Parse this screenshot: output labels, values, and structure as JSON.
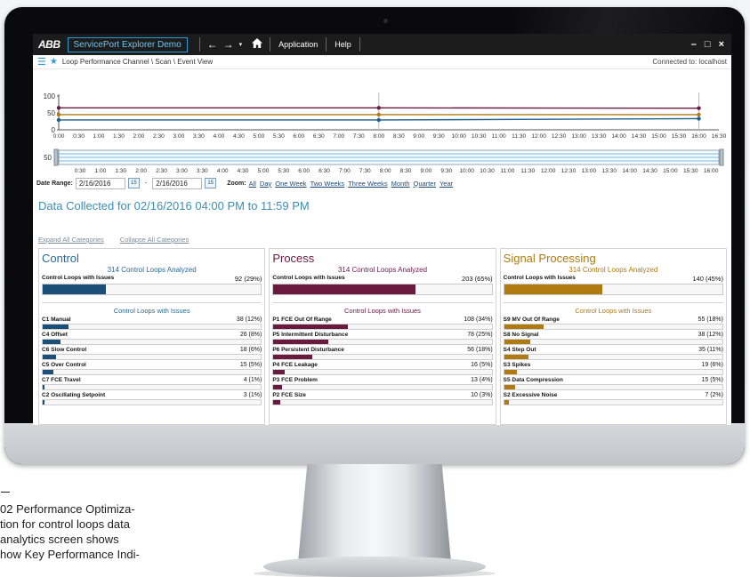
{
  "app": {
    "logo": "ABB",
    "title": "ServicePort Explorer Demo",
    "menu": [
      "Application",
      "Help"
    ],
    "window_controls": [
      "–",
      "□",
      "×"
    ]
  },
  "breadcrumb": "Loop Performance Channel \\ Scan \\ Event View",
  "connection": "Connected to: localhost",
  "chart_data": {
    "type": "line",
    "x": [
      "0:00",
      "0:30",
      "1:00",
      "1:30",
      "2:00",
      "2:30",
      "3:00",
      "3:30",
      "4:00",
      "4:30",
      "5:00",
      "5:30",
      "6:00",
      "6:30",
      "7:00",
      "7:30",
      "8:00",
      "8:30",
      "9:00",
      "9:30",
      "10:00",
      "10:30",
      "11:00",
      "11:30",
      "12:00",
      "12:30",
      "13:00",
      "13:30",
      "14:00",
      "14:30",
      "15:00",
      "15:30",
      "16:00",
      "16:30"
    ],
    "y_ticks": [
      "100",
      "50",
      "0"
    ],
    "ylim": [
      0,
      100
    ],
    "series": [
      {
        "points": [
          [
            0,
            65
          ],
          [
            16,
            65
          ],
          [
            32,
            64
          ]
        ],
        "color": "#6b1a3f"
      },
      {
        "points": [
          [
            0,
            45
          ],
          [
            16,
            45
          ],
          [
            32,
            45
          ]
        ],
        "color": "#b07a10"
      },
      {
        "points": [
          [
            0,
            29
          ],
          [
            16,
            29
          ],
          [
            32,
            33
          ]
        ],
        "color": "#1f5f8b"
      }
    ],
    "navigator": {
      "y_tick": "50",
      "x": [
        "0:30",
        "1:00",
        "1:30",
        "2:00",
        "2:30",
        "3:00",
        "3:30",
        "4:00",
        "4:30",
        "5:00",
        "5:30",
        "6:00",
        "6:30",
        "7:00",
        "7:30",
        "8:00",
        "8:30",
        "9:00",
        "9:30",
        "10:00",
        "10:30",
        "11:00",
        "11:30",
        "12:00",
        "12:30",
        "13:00",
        "13:30",
        "14:00",
        "14:30",
        "15:00",
        "15:30",
        "16:00"
      ]
    }
  },
  "date_range": {
    "label": "Date Range:",
    "from": "2/16/2016",
    "to": "2/16/2016",
    "separator": "-",
    "calendar_icon": "15",
    "zoom_label": "Zoom:",
    "zoom_links": [
      "All",
      "Day",
      "One Week",
      "Two Weeks",
      "Three Weeks",
      "Month",
      "Quarter",
      "Year"
    ]
  },
  "collected_title": "Data Collected for 02/16/2016 04:00 PM to 11:59 PM",
  "expand_all": "Expand All Categories",
  "collapse_all": "Collapse All Categories",
  "panels": [
    {
      "title": "Control",
      "color": "#1b4f78",
      "analyzed": "314 Control Loops Analyzed",
      "summary_label": "Control Loops with Issues",
      "summary_value": "92 (29%)",
      "summary_pct": 29,
      "sub_header": "Control Loops with Issues",
      "items": [
        {
          "label": "C1 Manual",
          "value": "38 (12%)",
          "pct": 12
        },
        {
          "label": "C4 Offset",
          "value": "26 (8%)",
          "pct": 8
        },
        {
          "label": "C6 Slow Control",
          "value": "18 (6%)",
          "pct": 6
        },
        {
          "label": "C5 Over Control",
          "value": "15 (5%)",
          "pct": 5
        },
        {
          "label": "C7 FCE Travel",
          "value": "4 (1%)",
          "pct": 1
        },
        {
          "label": "C2 Oscillating Setpoint",
          "value": "3 (1%)",
          "pct": 1
        }
      ]
    },
    {
      "title": "Process",
      "color": "#6b1a3f",
      "analyzed": "314 Control Loops Analyzed",
      "summary_label": "Control Loops with Issues",
      "summary_value": "203 (65%)",
      "summary_pct": 65,
      "sub_header": "Control Loops with Issues",
      "items": [
        {
          "label": "P1 FCE Out Of Range",
          "value": "108 (34%)",
          "pct": 34
        },
        {
          "label": "P5 Intermittent Disturbance",
          "value": "78 (25%)",
          "pct": 25
        },
        {
          "label": "P6 Persistent Disturbance",
          "value": "56 (18%)",
          "pct": 18
        },
        {
          "label": "P4 FCE Leakage",
          "value": "16 (5%)",
          "pct": 5
        },
        {
          "label": "P3 FCE Problem",
          "value": "13 (4%)",
          "pct": 4
        },
        {
          "label": "P2 FCE Size",
          "value": "10 (3%)",
          "pct": 3
        }
      ]
    },
    {
      "title": "Signal Processing",
      "color": "#b07a10",
      "analyzed": "314 Control Loops Analyzed",
      "summary_label": "Control Loops with Issues",
      "summary_value": "140 (45%)",
      "summary_pct": 45,
      "sub_header": "Control Loops with Issues",
      "items": [
        {
          "label": "S9 MV Out Of Range",
          "value": "55 (18%)",
          "pct": 18
        },
        {
          "label": "S8 No Signal",
          "value": "38 (12%)",
          "pct": 12
        },
        {
          "label": "S4 Step Out",
          "value": "35 (11%)",
          "pct": 11
        },
        {
          "label": "S3 Spikes",
          "value": "19 (6%)",
          "pct": 6
        },
        {
          "label": "S5 Data Compression",
          "value": "15 (5%)",
          "pct": 5
        },
        {
          "label": "S2 Excessive Noise",
          "value": "7 (2%)",
          "pct": 2
        }
      ]
    }
  ],
  "caption": {
    "line1": "02 Performance Optimiza-",
    "line2": "tion for control loops data",
    "line3": "analytics screen shows",
    "line4": "how Key Performance Indi-"
  }
}
